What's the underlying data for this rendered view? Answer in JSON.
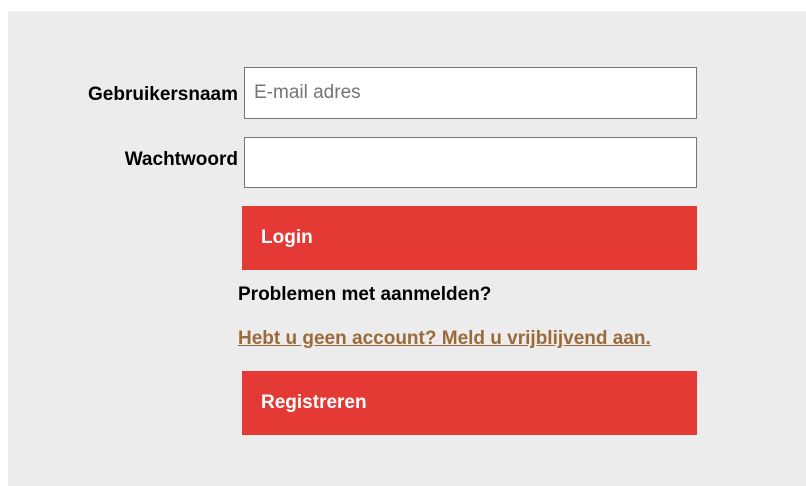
{
  "login_form": {
    "username_label": "Gebruikersnaam",
    "username_placeholder": "E-mail adres",
    "username_value": "",
    "password_label": "Wachtwoord",
    "password_value": "",
    "login_button_label": "Login",
    "problems_text": "Problemen met aanmelden?",
    "signup_link_text": "Hebt u geen account? Meld u vrijblijvend aan.",
    "register_button_label": "Registreren"
  },
  "colors": {
    "panel_background": "#ececec",
    "button_background": "#e53935",
    "button_text": "#ffffff",
    "link_color": "#9a6a3a"
  }
}
